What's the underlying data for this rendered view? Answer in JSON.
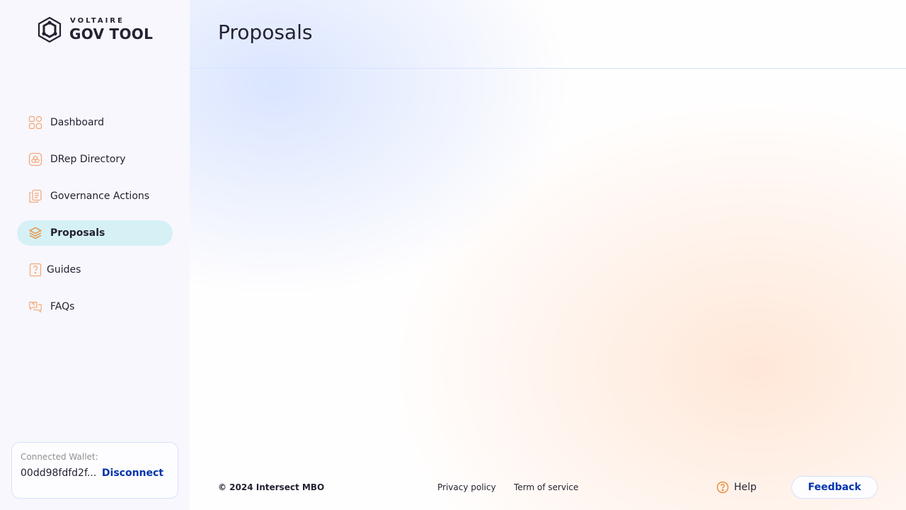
{
  "logo": {
    "top": "VOLTAIRE",
    "bottom": "GOV TOOL"
  },
  "sidebar": {
    "items": [
      {
        "label": "Dashboard",
        "icon": "dashboard-icon",
        "active": false
      },
      {
        "label": "DRep Directory",
        "icon": "drep-directory-icon",
        "active": false
      },
      {
        "label": "Governance Actions",
        "icon": "governance-actions-icon",
        "active": false
      },
      {
        "label": "Proposals",
        "icon": "proposals-icon",
        "active": true
      },
      {
        "label": "Guides",
        "icon": "guides-icon",
        "active": false
      },
      {
        "label": "FAQs",
        "icon": "faqs-icon",
        "active": false
      }
    ]
  },
  "wallet": {
    "caption": "Connected Wallet:",
    "id": "00dd98fdfd2f...",
    "disconnect_label": "Disconnect"
  },
  "header": {
    "title": "Proposals"
  },
  "footer": {
    "copyright": "© 2024 Intersect MBO",
    "privacy": "Privacy policy",
    "terms": "Term of service",
    "help": "Help",
    "feedback": "Feedback"
  },
  "colors": {
    "accent": "#0033ad",
    "icon_orange": "#f4a97a",
    "active_bg": "#d6f1f6",
    "border": "#d6e2ff"
  }
}
